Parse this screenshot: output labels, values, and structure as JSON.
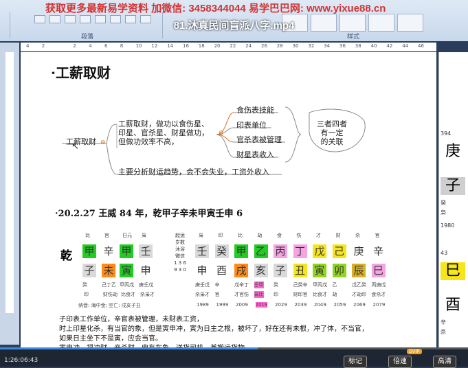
{
  "watermark": "获取更多最新易学资料 加微信: 3458344044 易学巴巴网: www.yixue88.cn",
  "video_title": "81.沐真民间盲派八字.mp4",
  "ribbon": {
    "group_paragraph": "段落",
    "group_styles": "样式"
  },
  "ruler_ticks": [
    "4",
    "2",
    "",
    "2",
    "4",
    "6",
    "8",
    "10",
    "12",
    "14",
    "16",
    "18",
    "20",
    "22",
    "24",
    "26",
    "28",
    "30",
    "32",
    "34",
    "36",
    "38",
    "40",
    "42",
    "44",
    "46"
  ],
  "heading": "工薪取财",
  "mindmap": {
    "root": "工薪取财",
    "branch1": [
      "工薪取财，做功以食伤星、",
      "印星、官杀星、财星做功，",
      "但做功效率不高，"
    ],
    "branch2": "主要分析财运趋势，会不会失业，工资外收入",
    "leaves": [
      "食伤表技能",
      "印表单位",
      "官杀表被管理",
      "财星表收入"
    ],
    "summary": [
      "三者四者",
      "有一定",
      "的关联"
    ]
  },
  "example_title": "20.2.27 王威 84 年，乾甲子辛未甲寅壬申 6",
  "bazi": {
    "qian": "乾",
    "pillar_headers": [
      "比",
      "官",
      "日元",
      "枭"
    ],
    "stems": [
      "甲",
      "辛",
      "甲",
      "壬"
    ],
    "branches": [
      "子",
      "未",
      "寅",
      "申"
    ],
    "hidden": [
      "癸",
      "己丁乙",
      "甲丙戊",
      "庚壬戊"
    ],
    "hidden2": [
      "印",
      "财伤劫",
      "比食才",
      "杀枭才"
    ],
    "nayin": "纳音: 海中金; 空亡: 戌亥子丑",
    "vertical_text": "起运 岁数 沐浴 微信 1 3 6 9 3 0",
    "dayun_headers": [
      "枭",
      "印",
      "比",
      "劫",
      "食",
      "伤",
      "才",
      "财",
      "杀",
      "官"
    ],
    "dayun_stems": [
      "壬",
      "癸",
      "甲",
      "乙",
      "丙",
      "丁",
      "戊",
      "己",
      "庚",
      "辛"
    ],
    "dayun_branches": [
      "申",
      "酉",
      "戌",
      "亥",
      "子",
      "丑",
      "寅",
      "卯",
      "辰",
      "巳"
    ],
    "dayun_hidden": [
      "庚壬戊",
      "辛",
      "戊辛丁",
      "壬甲",
      "癸",
      "己癸辛",
      "甲丙戊",
      "乙",
      "戊乙癸",
      "丙庚戊"
    ],
    "dayun_ten": [
      "杀枭才",
      "官",
      "才官伤",
      "枭比",
      "印",
      "财印官",
      "比食才",
      "劫",
      "才劫印",
      "食杀才"
    ],
    "years": [
      "1989",
      "1999",
      "2009",
      "2019",
      "2029",
      "2039",
      "2049",
      "2059",
      "2069",
      "2079"
    ],
    "colors": {
      "green": "#22cc22",
      "orange": "#ff8a1a",
      "grey": "#d9d9d9",
      "pink": "#f4a3e3",
      "yellow": "#f5e51a",
      "lime": "#8fd61c",
      "gold": "#d9b020",
      "white": "#ffffff"
    }
  },
  "paragraphs": [
    "子印表工作单位，辛官表被管理，未财表工资，",
    "时上印星化杀，有当官的象，但是寅申冲，寅为日主之根，被坏了，好在还有未根，冲了体，不当官，",
    "如果日主坐下不是寅，应会当官。",
    "寅申冲，禄冲财，辛杀财，申有车象，送货司机，兼搬运货物。"
  ],
  "right_pane": {
    "t1": "394",
    "c1": "庚",
    "c2": "子",
    "t2": "癸",
    "t3": "枭",
    "t4": "1980",
    "t5": "43",
    "c3": "巳",
    "c4": "酉",
    "t6": "辛",
    "t7": "杀"
  },
  "player": {
    "time": "1:26:06:43",
    "btn1": "标记",
    "btn2": "倍速",
    "btn3": "高清",
    "svip": "SVIP",
    "progress": 0.55
  }
}
